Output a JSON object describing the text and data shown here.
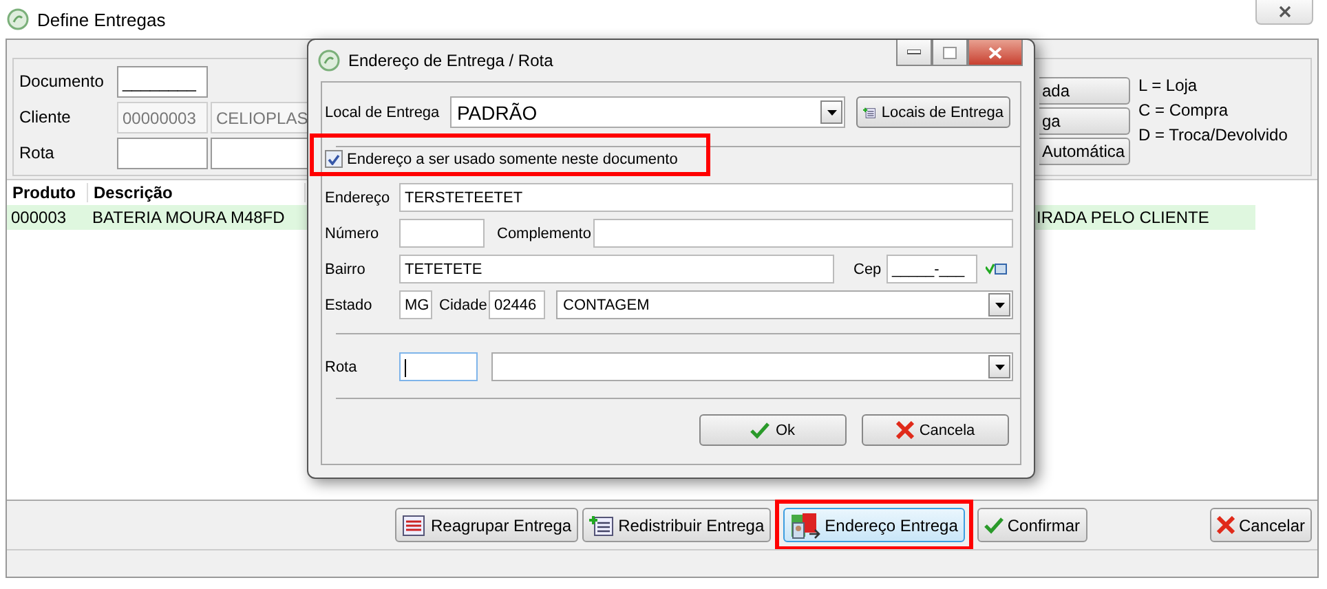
{
  "window": {
    "title": "Define Entregas"
  },
  "header": {
    "fields": [
      {
        "label": "Documento",
        "boxes": [
          {
            "value": "________",
            "disabled": false
          }
        ]
      },
      {
        "label": "Cliente",
        "boxes": [
          {
            "value": "00000003",
            "disabled": true
          },
          {
            "value": "CELIOPLAS",
            "disabled": true
          }
        ]
      },
      {
        "label": "Rota",
        "boxes": [
          {
            "disabled": false
          },
          {
            "disabled": false
          }
        ]
      }
    ],
    "side_buttons": [
      "ada",
      "ga",
      "Automática"
    ],
    "legend": [
      "L = Loja",
      "C = Compra",
      "D = Troca/Devolvido"
    ]
  },
  "table": {
    "columns": [
      "Produto",
      "Descrição"
    ],
    "rows": [
      {
        "cells": [
          "000003",
          "BATERIA MOURA M48FD",
          "IRADA PELO CLIENTE"
        ],
        "selected": true
      }
    ]
  },
  "toolbar": [
    {
      "label": "Reagrupar Entrega",
      "kind": "regroup",
      "focused": false,
      "highlighted": false
    },
    {
      "label": "Redistribuir Entrega",
      "kind": "redistribute",
      "focused": false,
      "highlighted": false
    },
    {
      "label": "Endereço Entrega",
      "kind": "address",
      "focused": true,
      "highlighted": true
    },
    {
      "label": "Confirmar",
      "kind": "confirm",
      "focused": false,
      "highlighted": false
    },
    {
      "label": "Cancelar",
      "kind": "cancel",
      "focused": false,
      "highlighted": false
    }
  ],
  "dialog": {
    "title": "Endereço de Entrega / Rota",
    "local": {
      "label": "Local de Entrega",
      "value": "PADRÃO",
      "button": "Locais de Entrega"
    },
    "checkbox": {
      "label": "Endereço a ser usado somente neste documento",
      "checked": true,
      "highlighted": true
    },
    "endereco": {
      "label": "Endereço",
      "value": "TERSTETEETET"
    },
    "numero": {
      "label": "Número"
    },
    "complemento": {
      "label": "Complemento"
    },
    "bairro": {
      "label": "Bairro",
      "value": "TETETETE"
    },
    "cep": {
      "label": "Cep",
      "value": "_____-___"
    },
    "estado": {
      "label": "Estado",
      "value": "MG"
    },
    "cidade": {
      "label": "Cidade",
      "code": "02446",
      "name": "CONTAGEM"
    },
    "rota": {
      "label": "Rota",
      "focused": true
    },
    "buttons": [
      {
        "label": "Ok",
        "kind": "confirm"
      },
      {
        "label": "Cancela",
        "kind": "cancel"
      }
    ]
  }
}
